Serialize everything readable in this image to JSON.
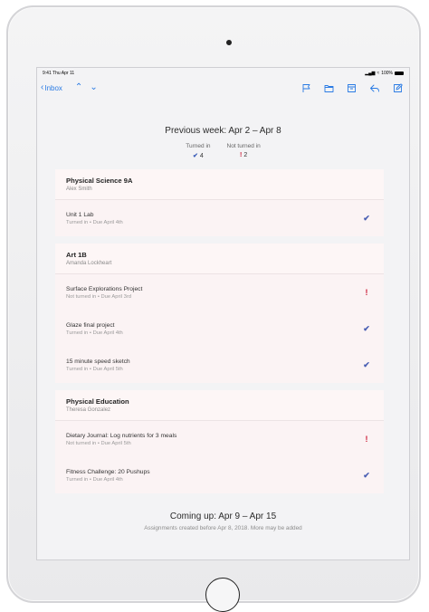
{
  "status_bar": {
    "time": "9:41",
    "day": "Thu Apr 11",
    "signal": "▂▄▆",
    "wifi": "≈",
    "battery_pct": "100%"
  },
  "nav": {
    "back_label": "Inbox",
    "back_icon": "‹",
    "up_icon": "⌃",
    "down_icon": "⌄"
  },
  "colors": {
    "accent": "#2a7be4",
    "turned_in": "#4a5fb3",
    "not_turned_in": "#cc1f3a",
    "card_bg": "#fbf3f4"
  },
  "summary": {
    "title": "Previous week: Apr 2 – Apr 8",
    "turned_in_label": "Turned in",
    "turned_in_icon": "✔",
    "turned_in_count": "4",
    "not_turned_in_label": "Not turned in",
    "not_turned_in_icon": "!",
    "not_turned_in_count": "2"
  },
  "classes": [
    {
      "name": "Physical Science 9A",
      "teacher": "Alex Smith",
      "assignments": [
        {
          "title": "Unit 1 Lab",
          "status": "Turned in",
          "sep": "•",
          "due": "Due April 4th",
          "icon": "✔"
        }
      ]
    },
    {
      "name": "Art 1B",
      "teacher": "Amanda Lockheart",
      "assignments": [
        {
          "title": "Surface Explorations Project",
          "status": "Not turned in",
          "sep": "•",
          "due": "Due April 3rd",
          "icon": "!"
        },
        {
          "title": "Glaze final project",
          "status": "Turned in",
          "sep": "•",
          "due": "Due April 4th",
          "icon": "✔"
        },
        {
          "title": "15 minute speed sketch",
          "status": "Turned in",
          "sep": "•",
          "due": "Due April 5th",
          "icon": "✔"
        }
      ]
    },
    {
      "name": "Physical Education",
      "teacher": "Theresa Gonzalez",
      "assignments": [
        {
          "title": "Dietary Journal: Log nutrients for 3 meals",
          "status": "Not turned in",
          "sep": "•",
          "due": "Due April 5th",
          "icon": "!"
        },
        {
          "title": "Fitness Challenge: 20 Pushups",
          "status": "Turned in",
          "sep": "•",
          "due": "Due April 4th",
          "icon": "✔"
        }
      ]
    }
  ],
  "coming_up": {
    "title": "Coming up: Apr 9 – Apr 15",
    "subtitle": "Assignments created before Apr 8, 2018. More may be added"
  }
}
